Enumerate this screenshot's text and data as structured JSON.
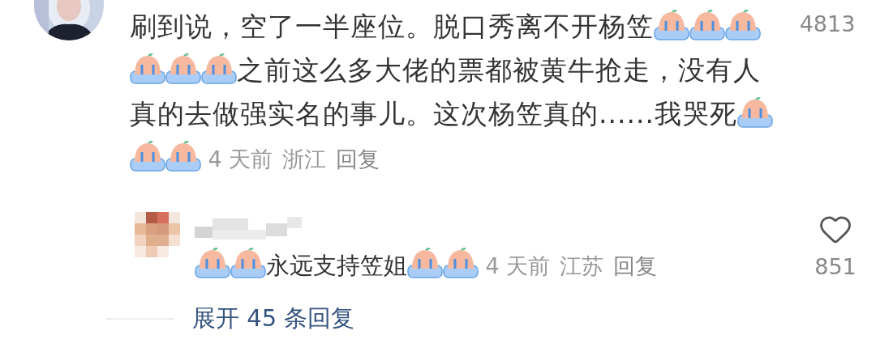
{
  "comment": {
    "content": [
      {
        "kind": "text",
        "text": "刷到说，空了一半座位。脱口秀离不开杨笠"
      },
      {
        "kind": "emoji"
      },
      {
        "kind": "emoji"
      },
      {
        "kind": "emoji"
      },
      {
        "kind": "emoji"
      },
      {
        "kind": "emoji"
      },
      {
        "kind": "emoji"
      },
      {
        "kind": "text",
        "text": "之前这么多大佬的票都被黄牛抢走，没有人真的去做强实名的事儿。这次杨笠真的......我哭死"
      },
      {
        "kind": "emoji"
      }
    ],
    "content_tail": [
      {
        "kind": "emoji"
      },
      {
        "kind": "emoji"
      }
    ],
    "time": "4 天前",
    "location": "浙江",
    "reply_label": "回复",
    "likes": "4813",
    "reply": {
      "content": [
        {
          "kind": "emoji"
        },
        {
          "kind": "emoji"
        },
        {
          "kind": "text",
          "text": "永远支持笠姐"
        },
        {
          "kind": "emoji"
        },
        {
          "kind": "emoji"
        }
      ],
      "time": "4 天前",
      "location": "江苏",
      "reply_label": "回复",
      "likes": "851"
    },
    "expand_link": "展开 45 条回复"
  }
}
